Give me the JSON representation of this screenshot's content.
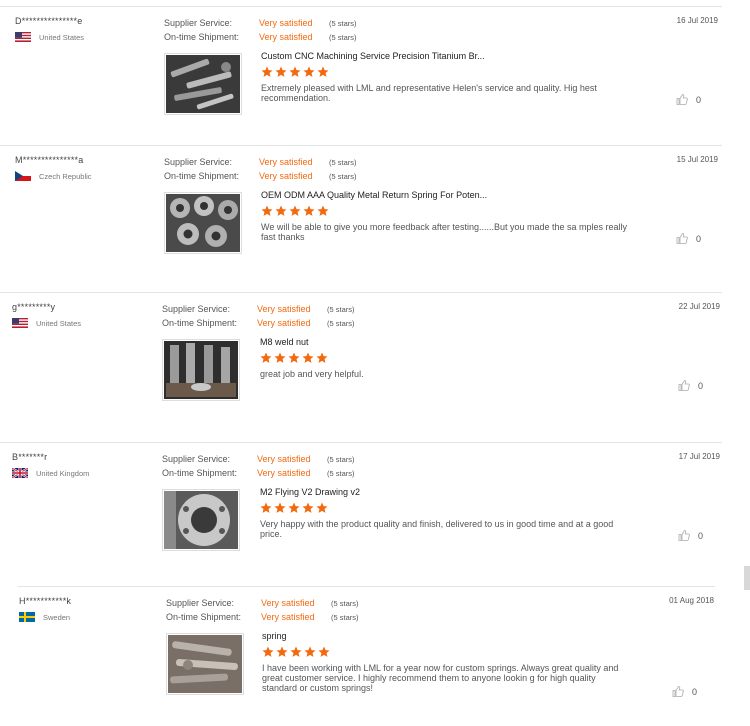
{
  "colors": {
    "accent": "#f26a10",
    "star": "#f26a10",
    "divider": "#e3e3e3"
  },
  "labels": {
    "supplier_service": "Supplier Service:",
    "on_time_shipment": "On-time Shipment:"
  },
  "reviews": [
    {
      "user": "D***************e",
      "country": "United States",
      "flag_icon": "flag-us-icon",
      "supplier_service": "Very satisfied",
      "supplier_stars": "(5 stars)",
      "shipment": "Very satisfied",
      "shipment_stars": "(5 stars)",
      "date": "16 Jul 2019",
      "product": "Custom CNC Machining Service Precision Titanium Br...",
      "rating": 5,
      "comment": "Extremely pleased with LML and representative Helen's service and quality.  Hig hest recommendation.",
      "likes": "0"
    },
    {
      "user": "M***************a",
      "country": "Czech Republic",
      "flag_icon": "flag-cz-icon",
      "supplier_service": "Very satisfied",
      "supplier_stars": "(5 stars)",
      "shipment": "Very satisfied",
      "shipment_stars": "(5 stars)",
      "date": "15 Jul 2019",
      "product": "OEM ODM AAA Quality Metal Return Spring For Poten...",
      "rating": 5,
      "comment": "We will be able to give you more feedback after testing......But you made the sa mples really fast thanks",
      "likes": "0"
    },
    {
      "user": "g*********y",
      "country": "United States",
      "flag_icon": "flag-us-icon",
      "supplier_service": "Very satisfied",
      "supplier_stars": "(5 stars)",
      "shipment": "Very satisfied",
      "shipment_stars": "(5 stars)",
      "date": "22 Jul 2019",
      "product": "M8 weld nut",
      "rating": 5,
      "comment": "great job and very helpful.",
      "likes": "0"
    },
    {
      "user": "B*******r",
      "country": "United Kingdom",
      "flag_icon": "flag-uk-icon",
      "supplier_service": "Very satisfied",
      "supplier_stars": "(5 stars)",
      "shipment": "Very satisfied",
      "shipment_stars": "(5 stars)",
      "date": "17 Jul 2019",
      "product": "M2 Flying V2 Drawing v2",
      "rating": 5,
      "comment": "Very happy with the product quality and finish, delivered to us in good time and at a good price.",
      "likes": "0"
    },
    {
      "user": "H***********k",
      "country": "Sweden",
      "flag_icon": "flag-se-icon",
      "supplier_service": "Very satisfied",
      "supplier_stars": "(5 stars)",
      "shipment": "Very satisfied",
      "shipment_stars": "(5 stars)",
      "date": "01 Aug 2018",
      "product": "spring",
      "rating": 5,
      "comment": "I have been working with LML for a year now for custom springs. Always great quality and great customer service. I highly recommend them to anyone lookin g for high quality standard or custom springs!",
      "likes": "0"
    }
  ]
}
